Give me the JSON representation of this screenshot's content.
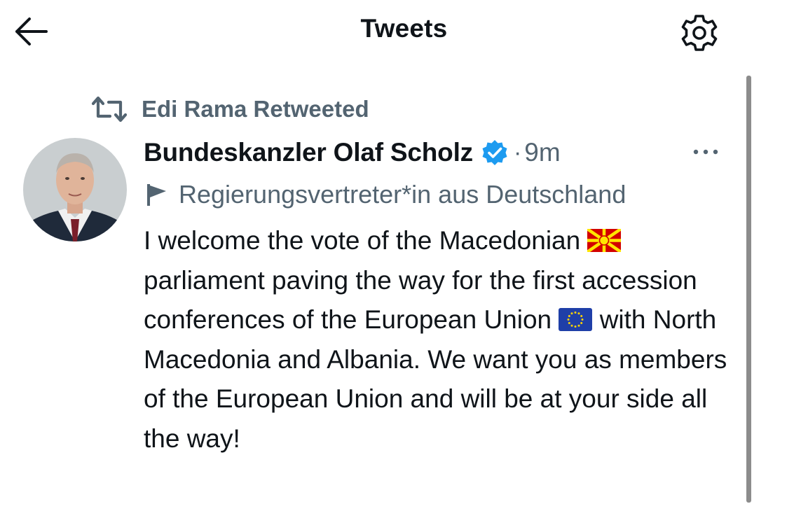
{
  "header": {
    "title": "Tweets",
    "back_icon": "arrow-left-icon",
    "settings_icon": "gear-icon"
  },
  "retweet_context": {
    "icon": "retweet-icon",
    "label": "Edi Rama Retweeted"
  },
  "tweet": {
    "author": {
      "display_name": "Bundeskanzler Olaf Scholz",
      "verified": true,
      "avatar_icon": "avatar"
    },
    "separator": "·",
    "time": "9m",
    "more_icon": "more-horizontal-icon",
    "label_icon": "flag-icon",
    "affiliation": "Regierungsvertreter*in aus Deutschland",
    "text": {
      "part1": "I welcome the vote of the Macedonian",
      "flag1": "north-macedonia-flag",
      "part2": "parliament paving the way for the first accession conferences of the European Union",
      "flag2": "eu-flag",
      "part3": "with North Macedonia and Albania. We want you as members of the European Union and will be at your side all the way!"
    }
  },
  "colors": {
    "text_primary": "#0f1419",
    "text_secondary": "#536471",
    "verified_blue": "#1d9bf0",
    "scrollbar": "#8c8c8c"
  }
}
